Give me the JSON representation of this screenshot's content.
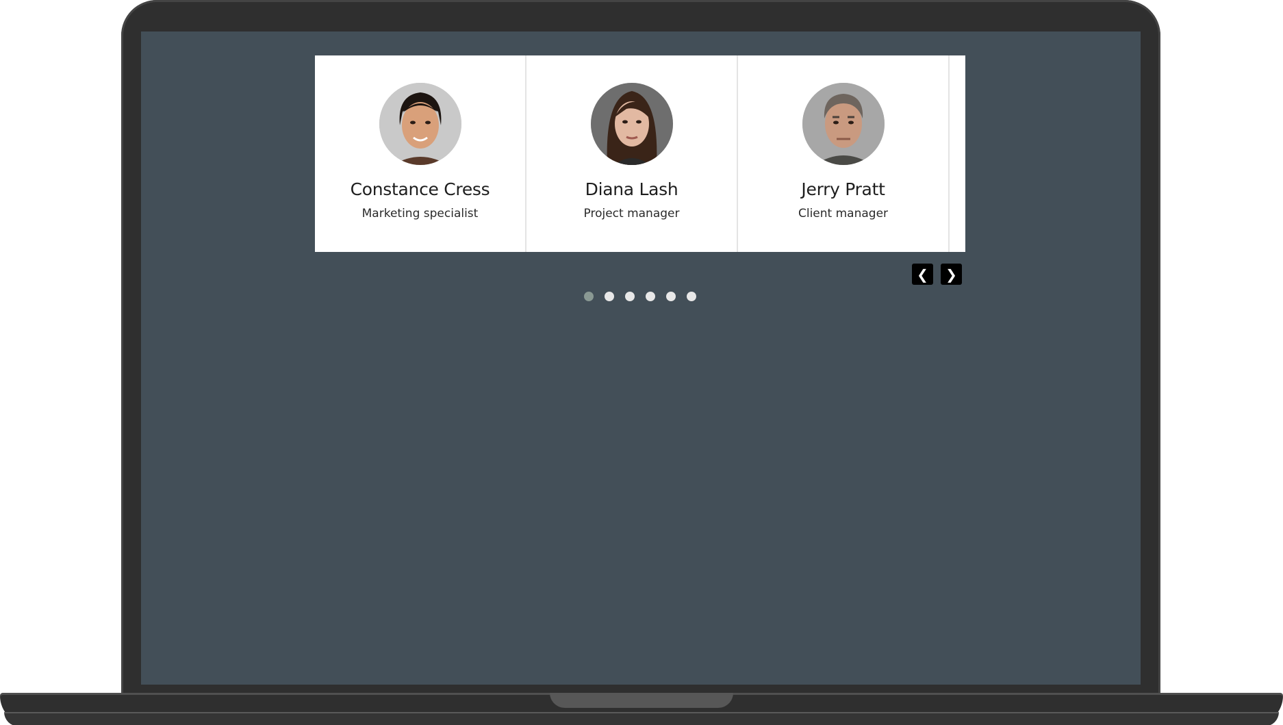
{
  "carousel": {
    "slides": [
      {
        "name": "Constance Cress",
        "role": "Marketing specialist",
        "avatar_icon": "woman-portrait-icon"
      },
      {
        "name": "Diana Lash",
        "role": "Project manager",
        "avatar_icon": "woman-portrait-icon"
      },
      {
        "name": "Jerry Pratt",
        "role": "Client manager",
        "avatar_icon": "man-portrait-icon"
      }
    ],
    "prev_label": "❮",
    "next_label": "❯",
    "dot_count": 6,
    "active_dot_index": 0
  },
  "colors": {
    "screen_background": "#434f58",
    "card_background": "#ffffff",
    "active_dot": "#8a9993",
    "inactive_dot": "#e8e8e8"
  }
}
